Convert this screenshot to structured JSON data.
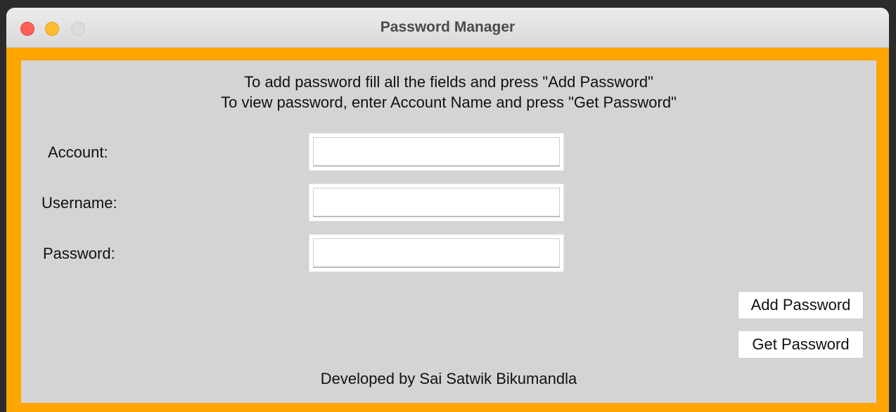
{
  "window": {
    "title": "Password Manager"
  },
  "instructions": {
    "line1": "To add password fill all the fields and press \"Add Password\"",
    "line2": "To view password, enter Account Name and press \"Get Password\""
  },
  "form": {
    "account_label": "Account:",
    "account_value": "",
    "username_label": "Username:",
    "username_value": "",
    "password_label": "Password:",
    "password_value": ""
  },
  "buttons": {
    "add_password": "Add Password",
    "get_password": "Get Password"
  },
  "footer": {
    "credit": "Developed by Sai Satwik Bikumandla"
  },
  "colors": {
    "frame": "#ffa500",
    "panel": "#d4d4d4",
    "close": "#fe5f57",
    "minimize": "#febc2e",
    "maximize_disabled": "#dcdcdc"
  }
}
